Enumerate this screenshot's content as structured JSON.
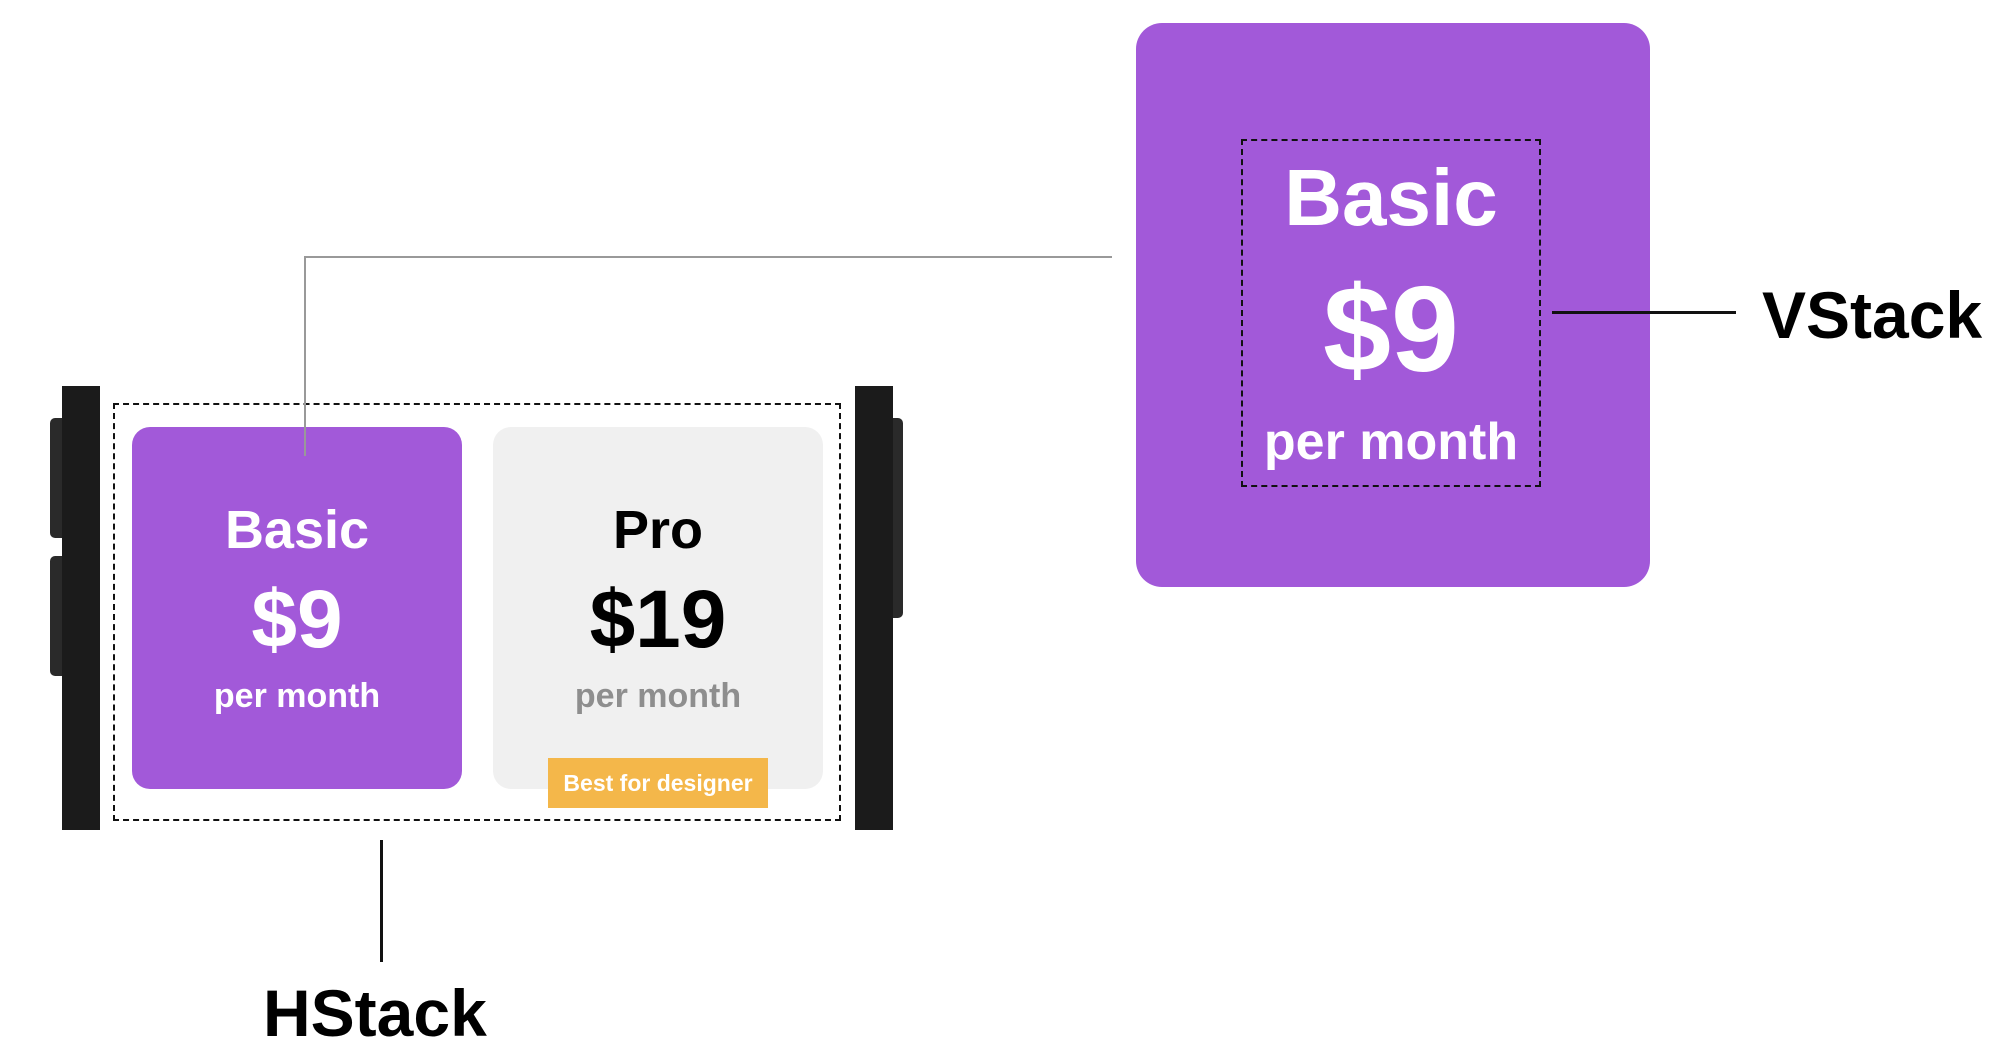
{
  "cards": {
    "basic": {
      "title": "Basic",
      "price": "$9",
      "period": "per month"
    },
    "pro": {
      "title": "Pro",
      "price": "$19",
      "period": "per month",
      "badge": "Best for designer"
    }
  },
  "zoom": {
    "title": "Basic",
    "price": "$9",
    "period": "per month"
  },
  "labels": {
    "vstack": "VStack",
    "hstack": "HStack"
  },
  "colors": {
    "basic_card": "#a259d9",
    "pro_card": "#f0f0f0",
    "badge": "#f4b74a",
    "frame": "#1b1b1b"
  }
}
